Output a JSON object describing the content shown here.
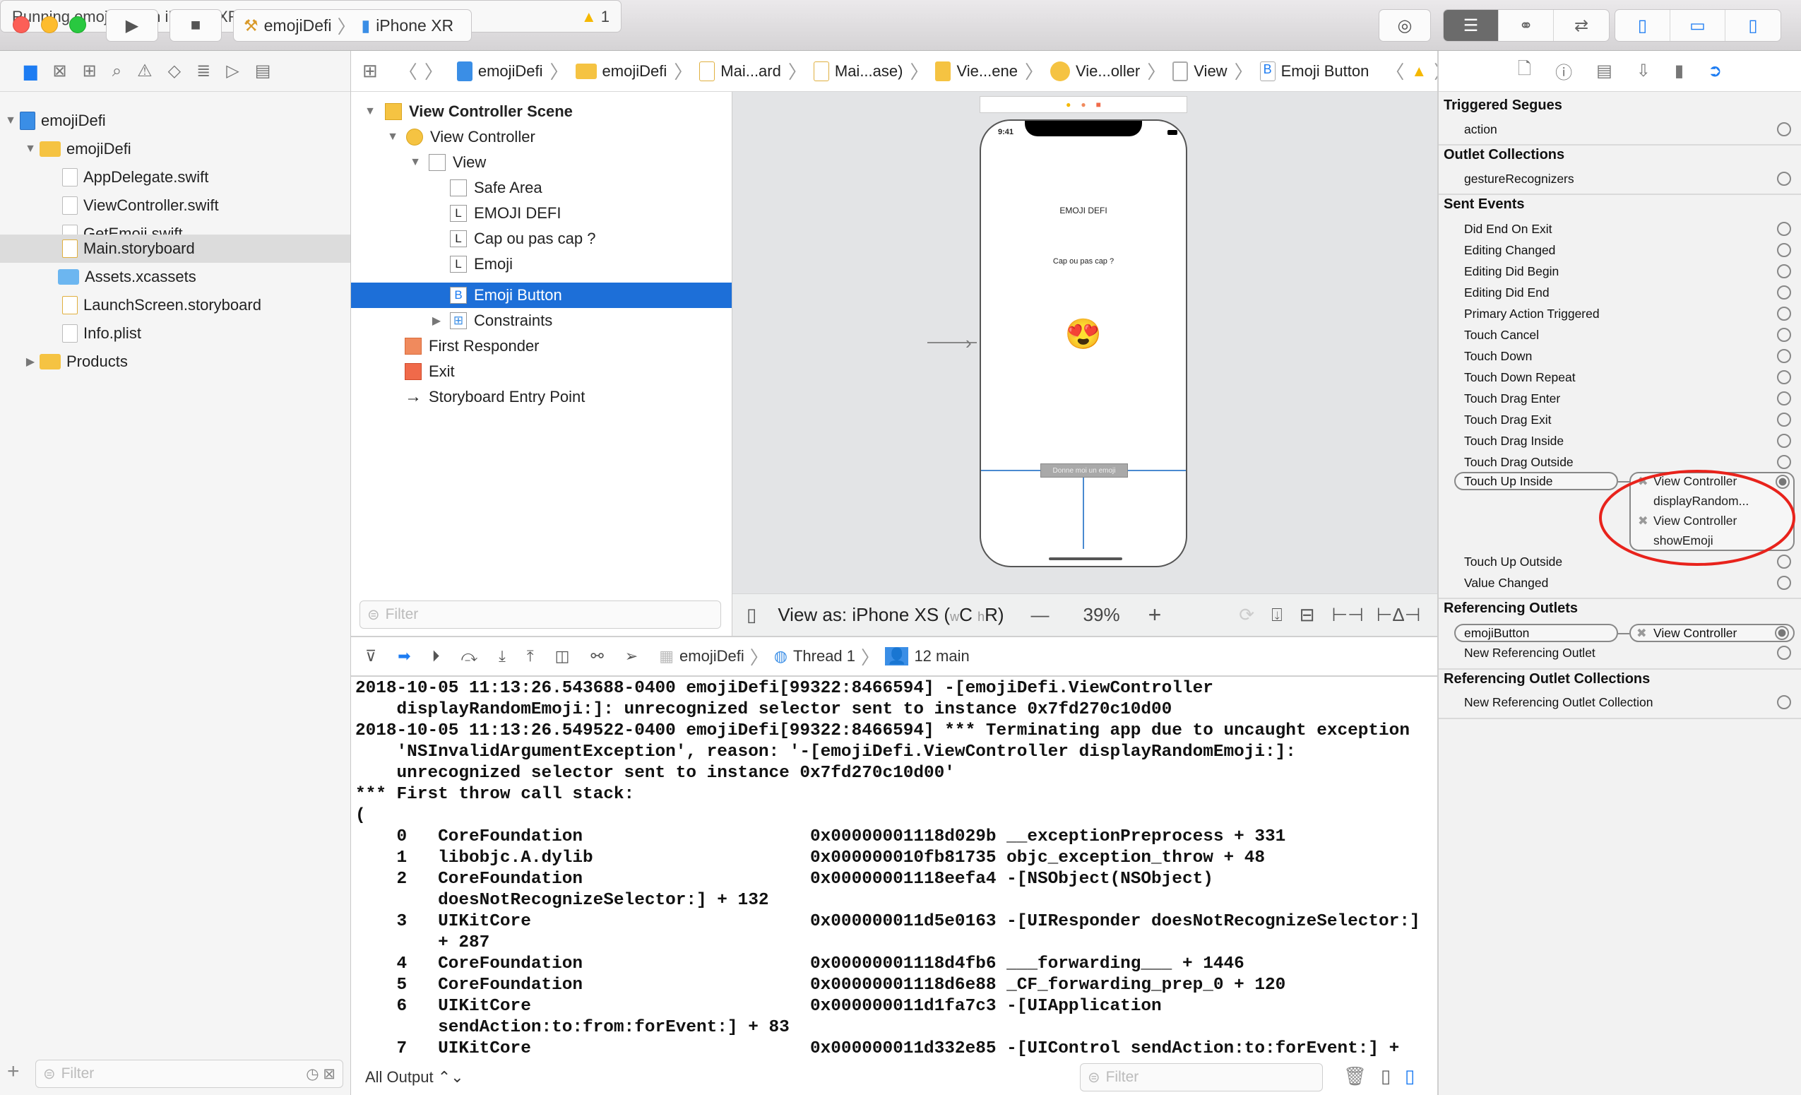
{
  "toolbar": {
    "scheme": "emojiDefi",
    "device": "iPhone XR",
    "activity": "Running emojiDefi on iPhone XR",
    "warning_count": "1"
  },
  "navigator": {
    "items": [
      {
        "label": "emojiDefi",
        "type": "project"
      },
      {
        "label": "emojiDefi",
        "type": "folder"
      },
      {
        "label": "AppDelegate.swift",
        "type": "swift"
      },
      {
        "label": "ViewController.swift",
        "type": "swift"
      },
      {
        "label": "GetEmoji.swift",
        "type": "swift"
      },
      {
        "label": "Main.storyboard",
        "type": "storyboard",
        "selected": true
      },
      {
        "label": "Assets.xcassets",
        "type": "assets"
      },
      {
        "label": "LaunchScreen.storyboard",
        "type": "storyboard"
      },
      {
        "label": "Info.plist",
        "type": "plist"
      },
      {
        "label": "Products",
        "type": "folder"
      }
    ],
    "filter_placeholder": "Filter"
  },
  "jumpbar": {
    "crumbs": [
      "emojiDefi",
      "emojiDefi",
      "Mai...ard",
      "Mai...ase)",
      "Vie...ene",
      "Vie...oller",
      "View",
      "Emoji Button"
    ]
  },
  "outline": {
    "items": [
      {
        "label": "View Controller Scene",
        "bold": true
      },
      {
        "label": "View Controller"
      },
      {
        "label": "View"
      },
      {
        "label": "Safe Area"
      },
      {
        "label": "EMOJI DEFI",
        "badge": "L"
      },
      {
        "label": "Cap ou pas cap ?",
        "badge": "L"
      },
      {
        "label": "Emoji",
        "badge": "L"
      },
      {
        "label": "Emoji Button",
        "badge": "B",
        "selected": true
      },
      {
        "label": "Constraints"
      },
      {
        "label": "First Responder"
      },
      {
        "label": "Exit"
      },
      {
        "label": "Storyboard Entry Point"
      }
    ],
    "filter_placeholder": "Filter"
  },
  "canvas": {
    "phone": {
      "time": "9:41",
      "title": "EMOJI DEFI",
      "subtitle": "Cap ou pas cap ?",
      "emoji": "😍",
      "button": "Donne moi un emoji"
    },
    "view_as_prefix": "View as: iPhone XS (",
    "size_w": "w",
    "size_wc": "C",
    "size_h": "h",
    "size_hr": "R)",
    "zoom": "39%",
    "zoom_out": "—",
    "zoom_in": "+"
  },
  "debug": {
    "process": "emojiDefi",
    "thread": "Thread 1",
    "frame": "12 main"
  },
  "console": {
    "lines": [
      "2018-10-05 11:13:26.543688-0400 emojiDefi[99322:8466594] -[emojiDefi.ViewController",
      "    displayRandomEmoji:]: unrecognized selector sent to instance 0x7fd270c10d00",
      "2018-10-05 11:13:26.549522-0400 emojiDefi[99322:8466594] *** Terminating app due to uncaught exception",
      "    'NSInvalidArgumentException', reason: '-[emojiDefi.ViewController displayRandomEmoji:]:",
      "    unrecognized selector sent to instance 0x7fd270c10d00'",
      "*** First throw call stack:",
      "(",
      "    0   CoreFoundation                      0x00000001118d029b __exceptionPreprocess + 331",
      "    1   libobjc.A.dylib                     0x000000010fb81735 objc_exception_throw + 48",
      "    2   CoreFoundation                      0x00000001118eefa4 -[NSObject(NSObject)",
      "        doesNotRecognizeSelector:] + 132",
      "    3   UIKitCore                           0x000000011d5e0163 -[UIResponder doesNotRecognizeSelector:]",
      "        + 287",
      "    4   CoreFoundation                      0x00000001118d4fb6 ___forwarding___ + 1446",
      "    5   CoreFoundation                      0x00000001118d6e88 _CF_forwarding_prep_0 + 120",
      "    6   UIKitCore                           0x000000011d1fa7c3 -[UIApplication",
      "        sendAction:to:from:forEvent:] + 83",
      "    7   UIKitCore                           0x000000011d332e85 -[UIControl sendAction:to:forEvent:] +"
    ],
    "output_selector": "All Output ⌃⌄",
    "filter_placeholder": "Filter"
  },
  "inspector": {
    "triggered_segues": {
      "title": "Triggered Segues",
      "items": [
        "action"
      ]
    },
    "outlet_collections": {
      "title": "Outlet Collections",
      "items": [
        "gestureRecognizers"
      ]
    },
    "sent_events": {
      "title": "Sent Events",
      "items": [
        "Did End On Exit",
        "Editing Changed",
        "Editing Did Begin",
        "Editing Did End",
        "Primary Action Triggered",
        "Touch Cancel",
        "Touch Down",
        "Touch Down Repeat",
        "Touch Drag Enter",
        "Touch Drag Exit",
        "Touch Drag Inside",
        "Touch Drag Outside"
      ],
      "touch_up_inside": "Touch Up Inside",
      "connections": [
        {
          "target": "View Controller",
          "action": "displayRandom..."
        },
        {
          "target": "View Controller",
          "action": "showEmoji"
        }
      ],
      "after": [
        "Touch Up Outside",
        "Value Changed"
      ]
    },
    "referencing_outlets": {
      "title": "Referencing Outlets",
      "outlet": "emojiButton",
      "target": "View Controller",
      "new": "New Referencing Outlet"
    },
    "referencing_outlet_collections": {
      "title": "Referencing Outlet Collections",
      "new": "New Referencing Outlet Collection"
    }
  },
  "colors": {
    "accent": "#1d6fd8",
    "annotation": "#e8231c",
    "warning": "#f5b800"
  }
}
